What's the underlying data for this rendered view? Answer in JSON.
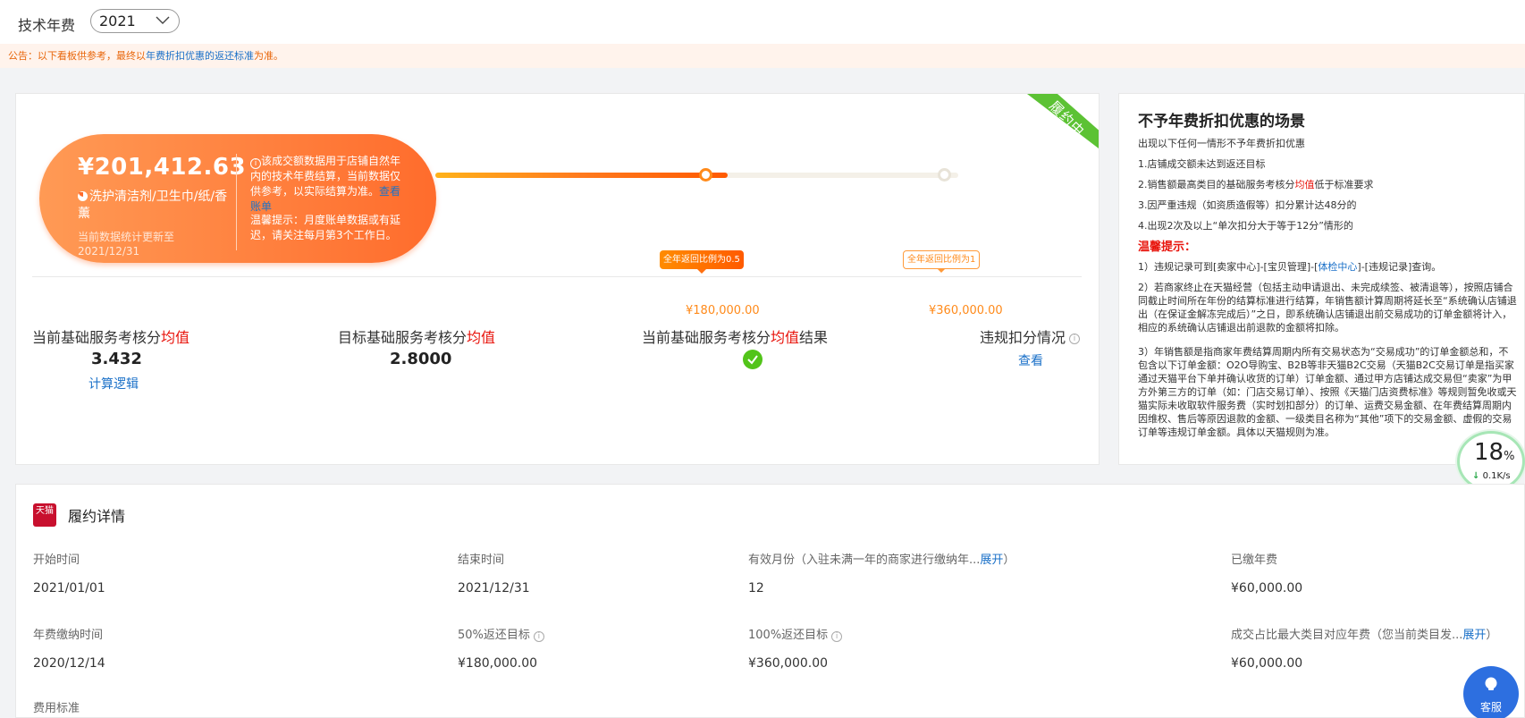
{
  "header": {
    "label": "技术年费",
    "year": "2021"
  },
  "notice": {
    "prefix": "公告：以下看板供参考，最终以",
    "link": "年费折扣优惠的返还标准",
    "suffix": "为准。"
  },
  "summary": {
    "ribbon": "履约中",
    "amount": "¥201,412.63",
    "category": "洗护清洁剂/卫生巾/纸/香薰",
    "update_note": "当前数据统计更新至2021/12/31",
    "info": "该成交额数据用于店铺自然年内的技术年费结算，当前数据仅供参考，以实际结算为准。",
    "bill_link": "查看账单",
    "tip": "温馨提示：月度账单数据或有延迟，请关注每月第3个工作日。",
    "progress": {
      "value": 0.5,
      "current": 201412.63,
      "max": 360000
    },
    "tag1": "全年返回比例为0.5",
    "tag2": "全年返回比例为1",
    "amount1": "¥180,000.00",
    "amount2": "¥360,000.00"
  },
  "metrics": [
    {
      "title_prefix": "当前基础服务考核分",
      "title_red": "均值",
      "title_suffix": "",
      "value": "3.432",
      "link": "计算逻辑"
    },
    {
      "title_prefix": "目标基础服务考核分",
      "title_red": "均值",
      "title_suffix": "",
      "value": "2.8000"
    },
    {
      "title_prefix": "当前基础服务考核分",
      "title_red": "均值",
      "title_suffix": "结果"
    },
    {
      "title_prefix": "违规扣分情况",
      "link": "查看"
    }
  ],
  "side": {
    "title": "不予年费折扣优惠的场景",
    "lines": [
      "出现以下任何一情形不予年费折扣优惠",
      "1.店铺成交额未达到返还目标",
      "2.销售额最高类目的基础服务考核分",
      "均值",
      "低于标准要求",
      "3.因严重违规（如资质造假等）扣分累计达48分的",
      "4.出现2次及以上“单次扣分大于等于12分”情形的"
    ],
    "warn": "温馨提示：",
    "para1_a": "1）违规记录可到[卖家中心]-[宝贝管理]-[",
    "para1_link": "体检中心",
    "para1_b": "]-[违规记录]查询。",
    "para2": "2）若商家终止在天猫经营（包括主动申请退出、未完成续签、被清退等），按照店铺合同截止时间所在年份的结算标准进行结算，年销售额计算周期将延长至“系统确认店铺退出（在保证金解冻完成后）”之日，即系统确认店铺退出前交易成功的订单金额将计入，相应的系统确认店铺退出前退款的金额将扣除。",
    "para3": "3）年销售额是指商家年费结算周期内所有交易状态为“交易成功”的订单金额总和，不包含以下订单金额：O2O导购宝、B2B等非天猫B2C交易（天猫B2C交易订单是指买家通过天猫平台下单并确认收货的订单）订单金额、通过甲方店铺达成交易但“卖家”为甲方外第三方的订单（如：门店交易订单）、按照《天猫门店资费标准》等规则暂免收或天猫实际未收取软件服务费（实时划扣部分）的订单、运费交易金额、在年费结算周期内因维权、售后等原因退款的金额、一级类目名称为“其他”项下的交易金额、虚假的交易订单等违规订单金额。具体以天猫规则为准。"
  },
  "speed": {
    "percent": "18",
    "unit": "%",
    "rate": "0.1K/s"
  },
  "detail": {
    "logo_text": "天猫",
    "title": "履约详情",
    "fields": [
      {
        "label": "开始时间",
        "value": "2021/01/01"
      },
      {
        "label": "结束时间",
        "value": "2021/12/31"
      },
      {
        "label": "有效月份（入驻未满一年的商家进行缴纳年...",
        "label_link": "展开",
        "label_suffix": "）",
        "value": "12"
      },
      {
        "label": "已缴年费",
        "value": "¥60,000.00"
      },
      {
        "label": "年费缴纳时间",
        "value": "2020/12/14"
      },
      {
        "label": "50%返还目标",
        "value": "¥180,000.00"
      },
      {
        "label": "100%返还目标",
        "value": "¥360,000.00"
      },
      {
        "label": "成交占比最大类目对应年费（您当前类目发...",
        "label_link": "展开",
        "label_suffix": "）",
        "value": "¥60,000.00"
      },
      {
        "label": "费用标准"
      }
    ]
  },
  "service": {
    "label": "客服"
  },
  "colors": {
    "accent": "#ff7a1e",
    "link": "#1a70c8",
    "red": "#e8140c",
    "green": "#52c41a"
  }
}
